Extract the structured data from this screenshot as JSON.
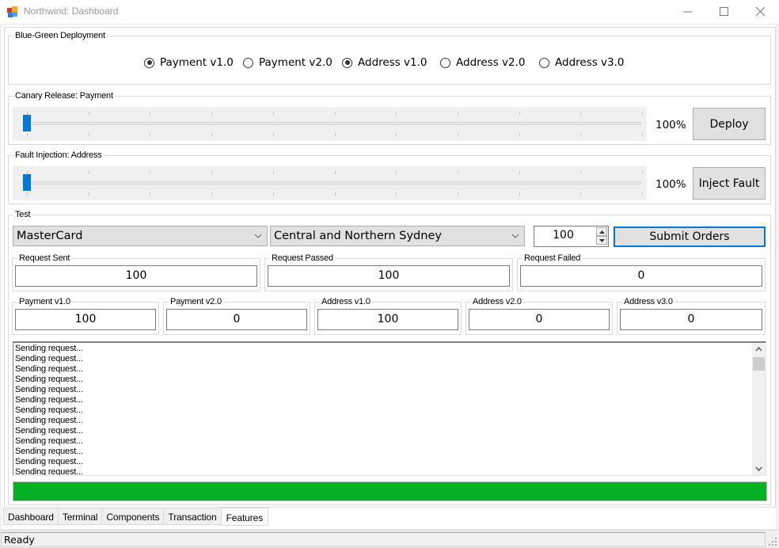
{
  "window": {
    "title": "Northwind: Dashboard",
    "minimize_icon": "minimize-icon",
    "maximize_icon": "maximize-icon",
    "close_icon": "close-icon"
  },
  "blue_green": {
    "label": "Blue-Green Deployment",
    "options": [
      {
        "label": "Payment v1.0",
        "checked": true
      },
      {
        "label": "Payment v2.0",
        "checked": false
      },
      {
        "label": "Address v1.0",
        "checked": true
      },
      {
        "label": "Address v2.0",
        "checked": false
      },
      {
        "label": "Address v3.0",
        "checked": false
      }
    ]
  },
  "canary": {
    "label": "Canary Release: Payment",
    "slider_value": 0,
    "slider_min": 0,
    "slider_max": 10,
    "percent_text": "100%",
    "button_label": "Deploy"
  },
  "fault": {
    "label": "Fault Injection: Address",
    "slider_value": 0,
    "slider_min": 0,
    "slider_max": 10,
    "percent_text": "100%",
    "button_label": "Inject Fault"
  },
  "test": {
    "label": "Test",
    "card_select": "MasterCard",
    "region_select": "Central and Northern Sydney",
    "order_count": "100",
    "submit_label": "Submit Orders",
    "stats": [
      {
        "label": "Request Sent",
        "value": "100"
      },
      {
        "label": "Request Passed",
        "value": "100"
      },
      {
        "label": "Request Failed",
        "value": "0"
      }
    ],
    "versions": [
      {
        "label": "Payment v1.0",
        "value": "100"
      },
      {
        "label": "Payment v2.0",
        "value": "0"
      },
      {
        "label": "Address v1.0",
        "value": "100"
      },
      {
        "label": "Address v2.0",
        "value": "0"
      },
      {
        "label": "Address v3.0",
        "value": "0"
      }
    ],
    "log_lines": [
      "Sending request...",
      "Sending request...",
      "Sending request...",
      "Sending request...",
      "Sending request...",
      "Sending request...",
      "Sending request...",
      "Sending request...",
      "Sending request...",
      "Sending request...",
      "Sending request...",
      "Sending request...",
      "Sending request..."
    ],
    "progress_percent": 100,
    "progress_color": "#06b025"
  },
  "tabs": [
    {
      "label": "Dashboard",
      "active": false
    },
    {
      "label": "Terminal",
      "active": false
    },
    {
      "label": "Components",
      "active": false
    },
    {
      "label": "Transaction",
      "active": false
    },
    {
      "label": "Features",
      "active": true
    }
  ],
  "status": {
    "text": "Ready"
  },
  "colors": {
    "accent": "#0078d7",
    "progress": "#06b025"
  }
}
